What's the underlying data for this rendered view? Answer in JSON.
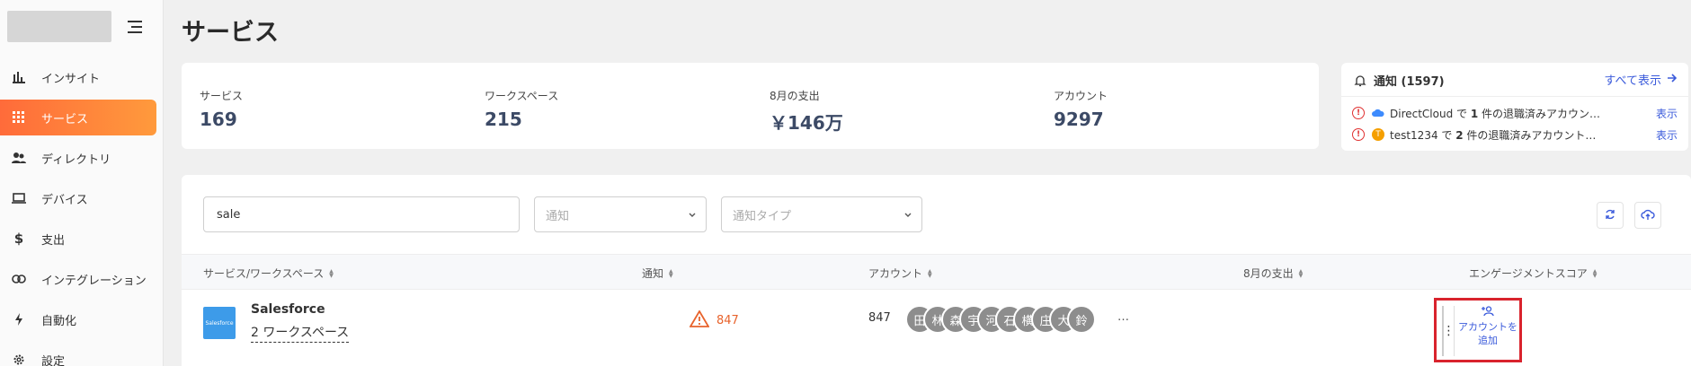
{
  "sidebar": {
    "items": [
      {
        "label": "インサイト",
        "icon": "bar-chart-icon"
      },
      {
        "label": "サービス",
        "icon": "grid-icon",
        "active": true
      },
      {
        "label": "ディレクトリ",
        "icon": "users-icon"
      },
      {
        "label": "デバイス",
        "icon": "laptop-icon"
      },
      {
        "label": "支出",
        "icon": "dollar-icon"
      },
      {
        "label": "インテグレーション",
        "icon": "link-icon"
      },
      {
        "label": "自動化",
        "icon": "bolt-icon"
      },
      {
        "label": "設定",
        "icon": "gear-icon"
      }
    ]
  },
  "page": {
    "title": "サービス"
  },
  "stats": [
    {
      "label": "サービス",
      "value": "169"
    },
    {
      "label": "ワークスペース",
      "value": "215"
    },
    {
      "label": "8月の支出",
      "value": "￥146万"
    },
    {
      "label": "アカウント",
      "value": "9297"
    }
  ],
  "notifications": {
    "title": "通知 (1597)",
    "show_all": "すべて表示",
    "items": [
      {
        "app": "DirectCloud",
        "pre": "DirectCloud で ",
        "count": "1",
        "post": " 件の退職済みアカウン…",
        "view": "表示"
      },
      {
        "app": "test1234",
        "pre": "test1234 で ",
        "count": "2",
        "post": " 件の退職済みアカウント…",
        "view": "表示"
      }
    ]
  },
  "filters": {
    "search_value": "sale",
    "notification_placeholder": "通知",
    "notification_type_placeholder": "通知タイプ"
  },
  "table": {
    "headers": [
      "サービス/ワークスペース",
      "通知",
      "アカウント",
      "8月の支出",
      "エンゲージメントスコア"
    ],
    "rows": [
      {
        "logo_text": "Salesforce",
        "name": "Salesforce",
        "workspaces": "2 ワークスペース",
        "alerts": "847",
        "accounts": "847",
        "avatars": [
          "田",
          "林",
          "森",
          "宇",
          "河",
          "石",
          "横",
          "庄",
          "大",
          "鈴"
        ],
        "more": "…",
        "action": "アカウントを追加"
      }
    ]
  },
  "colors": {
    "accent": "#ff7a3a",
    "link": "#3b5bdb",
    "alert": "#e8632c",
    "highlight": "#d9232d"
  }
}
